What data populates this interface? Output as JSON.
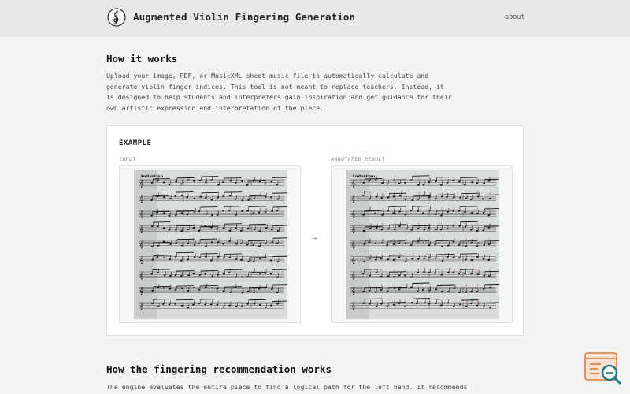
{
  "header": {
    "brand_title": "Augmented Violin Fingering Generation",
    "nav_about": "about",
    "logo_icon": "treble-clef-icon"
  },
  "how_it_works": {
    "heading": "How it works",
    "description": "Upload your image, PDF, or MusicXML sheet music file to automatically calculate and generate violin finger indices. This tool is not meant to replace teachers. Instead, it is designed to help students and interpreters gain inspiration and get guidance for their own artistic expression and interpretation of the piece."
  },
  "example": {
    "title": "EXAMPLE",
    "input_label": "INPUT",
    "result_label": "ANNOTATED RESULT",
    "arrow": "→",
    "score_tempo": "Andantino.",
    "arrow_icon": "arrow-right-icon"
  },
  "fingering": {
    "heading": "How the fingering recommendation works",
    "description_partial": "The engine evaluates the entire piece to find a logical path for the left hand. It recommends"
  },
  "colors": {
    "header_bg": "#e8e8e8",
    "page_bg": "#f3f3f3",
    "annotation": "#d03a52",
    "fab_accent": "#e07a3a",
    "fab_lens": "#1f7a8a"
  }
}
